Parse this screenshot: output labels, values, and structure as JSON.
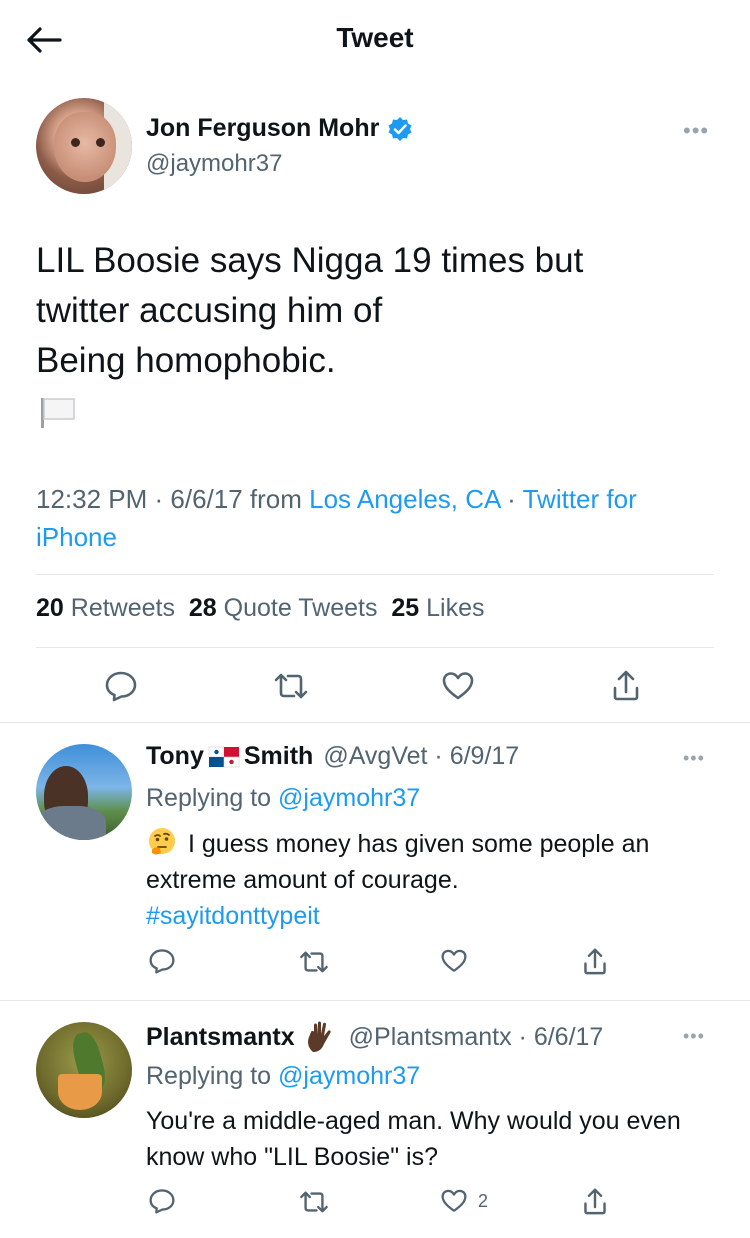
{
  "header": {
    "title": "Tweet"
  },
  "main_tweet": {
    "author_name": "Jon Ferguson Mohr",
    "author_handle": "@jaymohr37",
    "text_line1": "LIL Boosie says Nigga 19 times but",
    "text_line2": "twitter accusing him of",
    "text_line3": "Being homophobic.",
    "time": "12:32 PM · 6/6/17 from ",
    "location": "Los Angeles, CA",
    "sep": " · ",
    "client": "Twitter for iPhone",
    "retweets_count": "20",
    "retweets_label": "Retweets",
    "quotes_count": "28",
    "quotes_label": "Quote Tweets",
    "likes_count": "25",
    "likes_label": "Likes"
  },
  "replies": [
    {
      "name_first": "Tony",
      "name_last": "Smith",
      "handle_date": "@AvgVet · 6/9/17",
      "replying_prefix": "Replying to ",
      "replying_handle": "@jaymohr37",
      "text": "I guess money has given some people an extreme amount of courage.",
      "hashtag": "#sayitdonttypeit"
    },
    {
      "name": "Plantsmantx",
      "handle_date": "@Plantsmantx · 6/6/17",
      "replying_prefix": "Replying to ",
      "replying_handle": "@jaymohr37",
      "text": "You're a middle-aged man. Why would you even know who \"LIL Boosie\" is?",
      "like_count": "2"
    }
  ],
  "colors": {
    "accent": "#1d9bf0",
    "text": "#0f1419",
    "muted": "#536471",
    "divider": "#e6e9eb"
  }
}
